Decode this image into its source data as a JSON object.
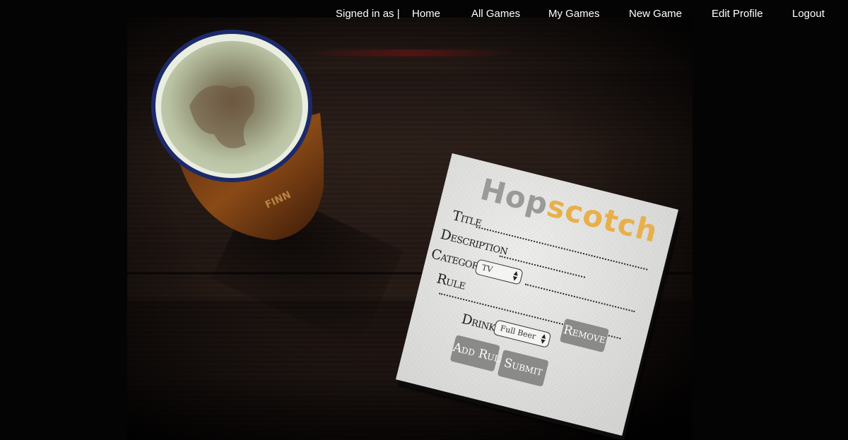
{
  "nav": {
    "signed_in": "Signed in as |",
    "items": [
      {
        "label": "Home"
      },
      {
        "label": "All Games"
      },
      {
        "label": "My Games"
      },
      {
        "label": "New Game"
      },
      {
        "label": "Edit Profile"
      },
      {
        "label": "Logout"
      }
    ]
  },
  "brand": {
    "part1": "Hop",
    "part2": "scotch",
    "part1_color": "#9a9a98",
    "part2_color": "#e8b04a"
  },
  "form": {
    "title_label": "Title",
    "description_label": "Description",
    "category_label": "Category",
    "category_value": "TV",
    "rule_label": "Rule",
    "drink_label": "Drink",
    "drink_value": "Full Beer",
    "remove_label": "Remove",
    "add_rule_label": "Add Rule",
    "submit_label": "Submit"
  }
}
